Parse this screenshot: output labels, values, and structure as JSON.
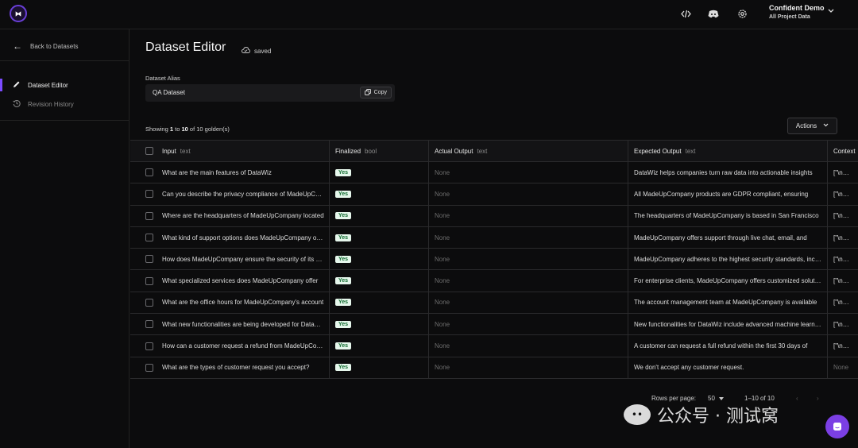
{
  "header": {
    "logo_glyph": "⧓",
    "user_name": "Confident Demo",
    "project": "All Project Data"
  },
  "sidebar": {
    "back_label": "Back to Datasets",
    "items": [
      {
        "label": "Dataset Editor",
        "icon": "pencil-icon"
      },
      {
        "label": "Revision History",
        "icon": "history-icon"
      }
    ]
  },
  "main": {
    "title": "Dataset Editor",
    "saved_label": "saved",
    "alias_label": "Dataset Alias",
    "alias_value": "QA Dataset",
    "copy_label": "Copy",
    "showing_prefix": "Showing ",
    "showing_range_start": "1",
    "showing_to": " to ",
    "showing_range_end": "10",
    "showing_suffix": " of 10 golden(s)",
    "actions_label": "Actions"
  },
  "table": {
    "columns": [
      {
        "name": "Input",
        "type": "text"
      },
      {
        "name": "Finalized",
        "type": "bool"
      },
      {
        "name": "Actual Output",
        "type": "text"
      },
      {
        "name": "Expected Output",
        "type": "text"
      },
      {
        "name": "Context",
        "type": ""
      }
    ],
    "rows": [
      {
        "input": "What are the main features of DataWiz",
        "finalized": "Yes",
        "actual": "None",
        "expected": "DataWiz helps companies turn raw data into actionable insights",
        "context": "[\"\\nAbou"
      },
      {
        "input": "Can you describe the privacy compliance of MadeUpCompany",
        "finalized": "Yes",
        "actual": "None",
        "expected": "All MadeUpCompany products are GDPR compliant, ensuring",
        "context": "[\"\\nAbou"
      },
      {
        "input": "Where are the headquarters of MadeUpCompany located",
        "finalized": "Yes",
        "actual": "None",
        "expected": "The headquarters of MadeUpCompany is based in San Francisco",
        "context": "[\"\\nAbou"
      },
      {
        "input": "What kind of support options does MadeUpCompany offer",
        "finalized": "Yes",
        "actual": "None",
        "expected": "MadeUpCompany offers support through live chat, email, and",
        "context": "[\"\\nAbou"
      },
      {
        "input": "How does MadeUpCompany ensure the security of its data",
        "finalized": "Yes",
        "actual": "None",
        "expected": "MadeUpCompany adheres to the highest security standards, including",
        "context": "[\"\\nAbou"
      },
      {
        "input": "What specialized services does MadeUpCompany offer",
        "finalized": "Yes",
        "actual": "None",
        "expected": "For enterprise clients, MadeUpCompany offers customized solutions",
        "context": "[\"\\nAbou"
      },
      {
        "input": "What are the office hours for MadeUpCompany's account",
        "finalized": "Yes",
        "actual": "None",
        "expected": "The account management team at MadeUpCompany is available",
        "context": "[\"\\nAbou"
      },
      {
        "input": "What new functionalities are being developed for DataWiz",
        "finalized": "Yes",
        "actual": "None",
        "expected": "New functionalities for DataWiz include advanced machine learning",
        "context": "[\"\\nAbou"
      },
      {
        "input": "How can a customer request a refund from MadeUpCompany",
        "finalized": "Yes",
        "actual": "None",
        "expected": "A customer can request a full refund within the first 30 days of",
        "context": "[\"\\nAbou"
      },
      {
        "input": "What are the types of customer request you accept?",
        "finalized": "Yes",
        "actual": "None",
        "expected": "We don't accept any customer request.",
        "context": "None"
      }
    ]
  },
  "pagination": {
    "rows_per_page_label": "Rows per page:",
    "rows_per_page_value": "50",
    "range": "1–10 of 10"
  },
  "watermark": {
    "text": "公众号 · 测试窝"
  },
  "colors": {
    "accent": "#7b4bff",
    "yes_bg": "#e6f7ec",
    "yes_text": "#106b2f"
  }
}
